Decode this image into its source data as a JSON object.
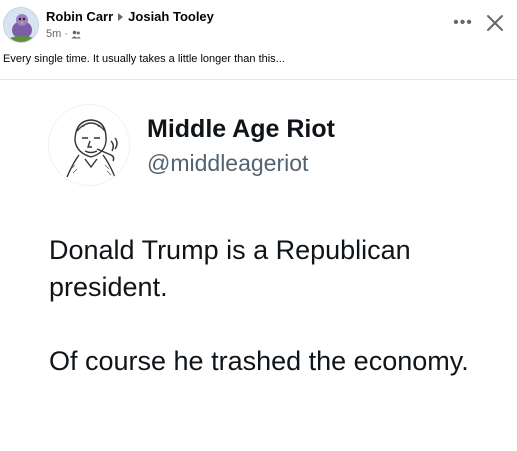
{
  "post": {
    "author": "Robin Carr",
    "recipient": "Josiah Tooley",
    "time": "5m",
    "audience_icon": "friends-icon",
    "caption": "Every single time. It usually takes a little longer than this..."
  },
  "actions": {
    "more_icon": "more-options-icon",
    "more_label": "•••",
    "close_icon": "close-icon"
  },
  "tweet": {
    "name": "Middle Age Riot",
    "handle": "@middleageriot",
    "paragraphs": [
      "Donald Trump is a Republican president.",
      "Of course he trashed the economy."
    ]
  },
  "colors": {
    "secondary_text": "#65676b",
    "handle": "#536471",
    "divider": "#e4e6eb"
  }
}
